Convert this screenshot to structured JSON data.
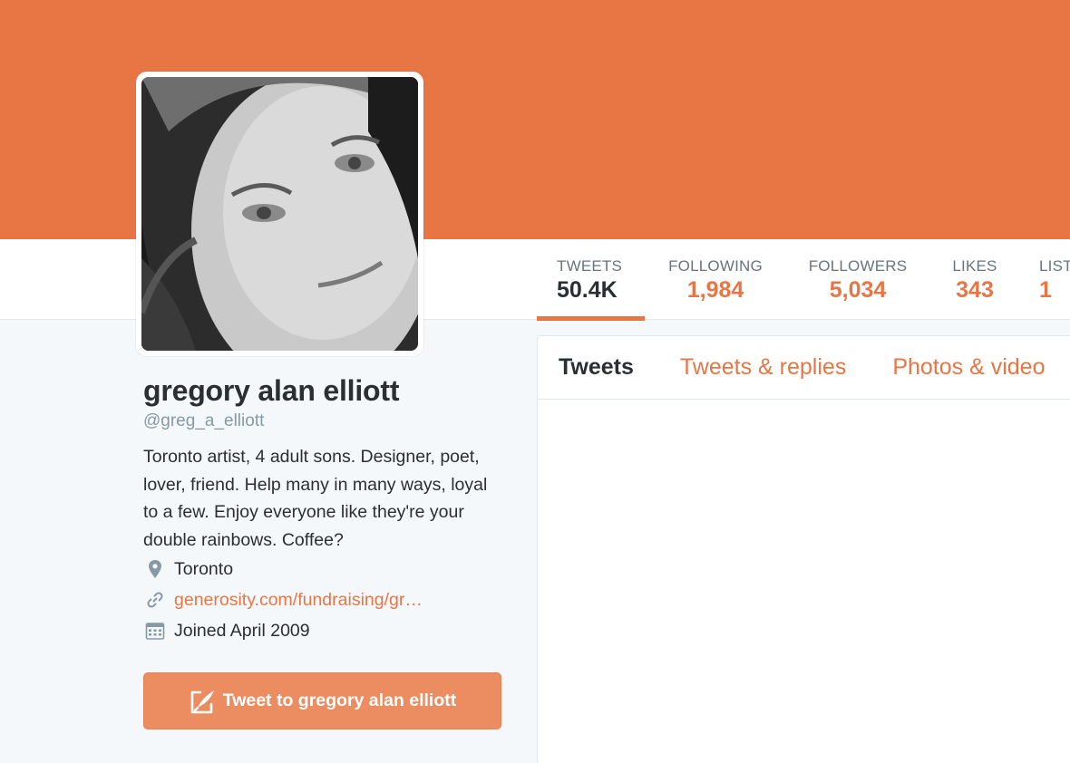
{
  "colors": {
    "accent": "#e87544",
    "button": "#ec8c61",
    "text": "#292f33",
    "muted": "#8899a6"
  },
  "stats": {
    "tweets": {
      "label": "TWEETS",
      "value": "50.4K"
    },
    "following": {
      "label": "FOLLOWING",
      "value": "1,984"
    },
    "followers": {
      "label": "FOLLOWERS",
      "value": "5,034"
    },
    "likes": {
      "label": "LIKES",
      "value": "343"
    },
    "lists": {
      "label": "LIST",
      "value": "1"
    }
  },
  "profile": {
    "name": "gregory alan elliott",
    "handle": "@greg_a_elliott",
    "bio": "Toronto artist, 4 adult sons. Designer, poet, lover, friend. Help many in many ways, loyal to a few. Enjoy everyone like they're your double rainbows. Coffee?",
    "location": "Toronto",
    "website": "generosity.com/fundraising/gr…",
    "joined": "Joined April 2009",
    "location_icon": "map-pin-icon",
    "link_icon": "link-icon",
    "calendar_icon": "calendar-icon"
  },
  "tweet_to_button": {
    "label": "Tweet to gregory alan elliott",
    "icon": "compose-icon"
  },
  "timeline": {
    "tabs": [
      {
        "label": "Tweets"
      },
      {
        "label": "Tweets & replies"
      },
      {
        "label": "Photos & video"
      }
    ]
  }
}
